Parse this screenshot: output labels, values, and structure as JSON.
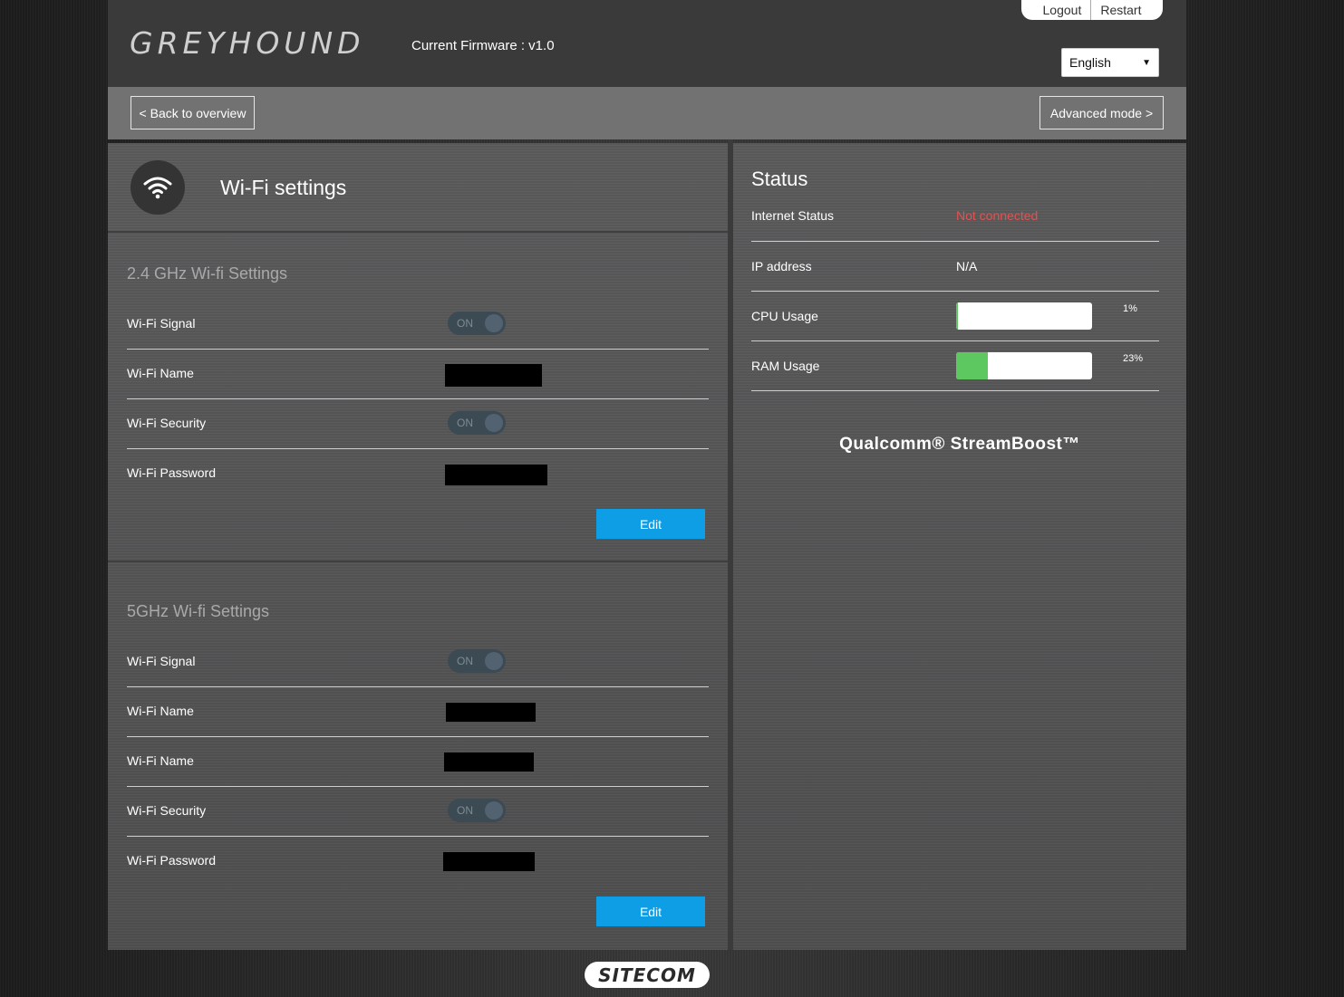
{
  "header": {
    "logo_text": "GREYHOUND",
    "firmware": "Current Firmware : v1.0",
    "logout_label": "Logout",
    "restart_label": "Restart",
    "language": "English"
  },
  "toolbar": {
    "back_label": "< Back to overview",
    "advanced_label": "Advanced mode >"
  },
  "wifi": {
    "title": "Wi-Fi settings",
    "band24": {
      "title": "2.4 GHz Wi-fi Settings",
      "signal_label": "Wi-Fi Signal",
      "signal_state": "ON",
      "name_label": "Wi-Fi Name",
      "security_label": "Wi-Fi Security",
      "security_state": "ON",
      "password_label": "Wi-Fi Password",
      "edit_label": "Edit"
    },
    "band5": {
      "title": "5GHz Wi-fi Settings",
      "signal_label": "Wi-Fi Signal",
      "signal_state": "ON",
      "name_label": "Wi-Fi Name",
      "name2_label": "Wi-Fi Name",
      "security_label": "Wi-Fi Security",
      "security_state": "ON",
      "password_label": "Wi-Fi Password",
      "edit_label": "Edit"
    }
  },
  "status": {
    "title": "Status",
    "internet_label": "Internet Status",
    "internet_value": "Not connected",
    "ip_label": "IP address",
    "ip_value": "N/A",
    "cpu_label": "CPU Usage",
    "cpu_value": "1%",
    "cpu_fraction": 0.01,
    "ram_label": "RAM Usage",
    "ram_value": "23%",
    "ram_fraction": 0.23,
    "qualcomm": "Qualcomm® StreamBoost™"
  },
  "footer": {
    "brand": "SITECOM"
  },
  "colors": {
    "accent_blue": "#0d9ee6",
    "error_red": "#e25252",
    "usage_green": "#5cc85f"
  }
}
